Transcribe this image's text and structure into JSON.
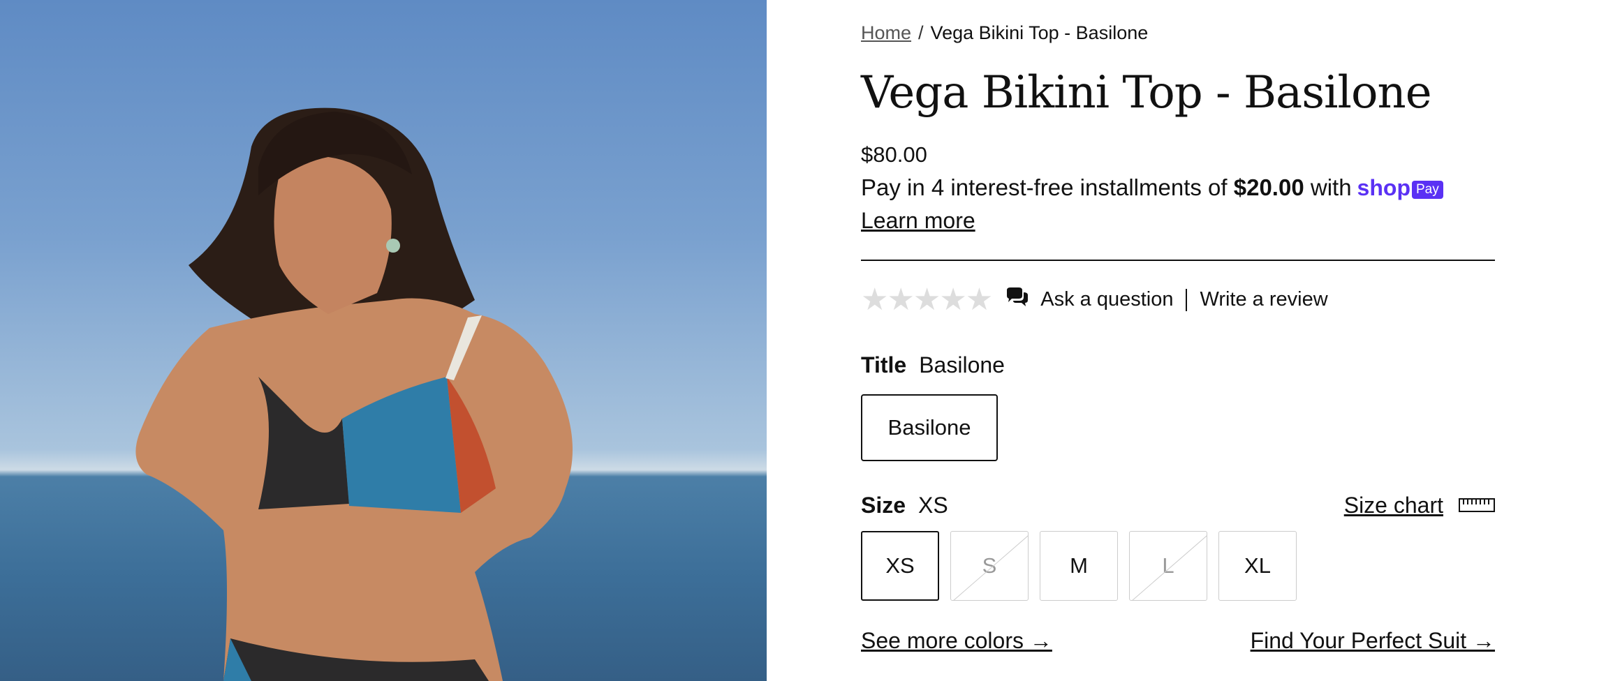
{
  "breadcrumb": {
    "home": "Home",
    "separator": "/",
    "current": "Vega Bikini Top - Basilone"
  },
  "product": {
    "title": "Vega Bikini Top - Basilone",
    "price": "$80.00",
    "installments": {
      "prefix": "Pay in 4 interest-free installments of",
      "amount": "$20.00",
      "suffix": "with",
      "brand": "shop",
      "badge": "Pay"
    },
    "learn_more": "Learn more"
  },
  "reviews": {
    "stars": "★★★★★",
    "rating": 0,
    "ask": "Ask a question",
    "write": "Write a review"
  },
  "options": {
    "title": {
      "label": "Title",
      "selected": "Basilone",
      "values": [
        "Basilone"
      ]
    },
    "size": {
      "label": "Size",
      "selected": "XS",
      "size_chart": "Size chart",
      "values": [
        {
          "label": "XS",
          "state": "selected"
        },
        {
          "label": "S",
          "state": "unavailable"
        },
        {
          "label": "M",
          "state": "available"
        },
        {
          "label": "L",
          "state": "unavailable"
        },
        {
          "label": "XL",
          "state": "available"
        }
      ]
    }
  },
  "links": {
    "more_colors": "See more colors →",
    "perfect_suit": "Find Your Perfect Suit →"
  },
  "colors": {
    "shop_pay": "#5a31f4",
    "text": "#111111"
  }
}
